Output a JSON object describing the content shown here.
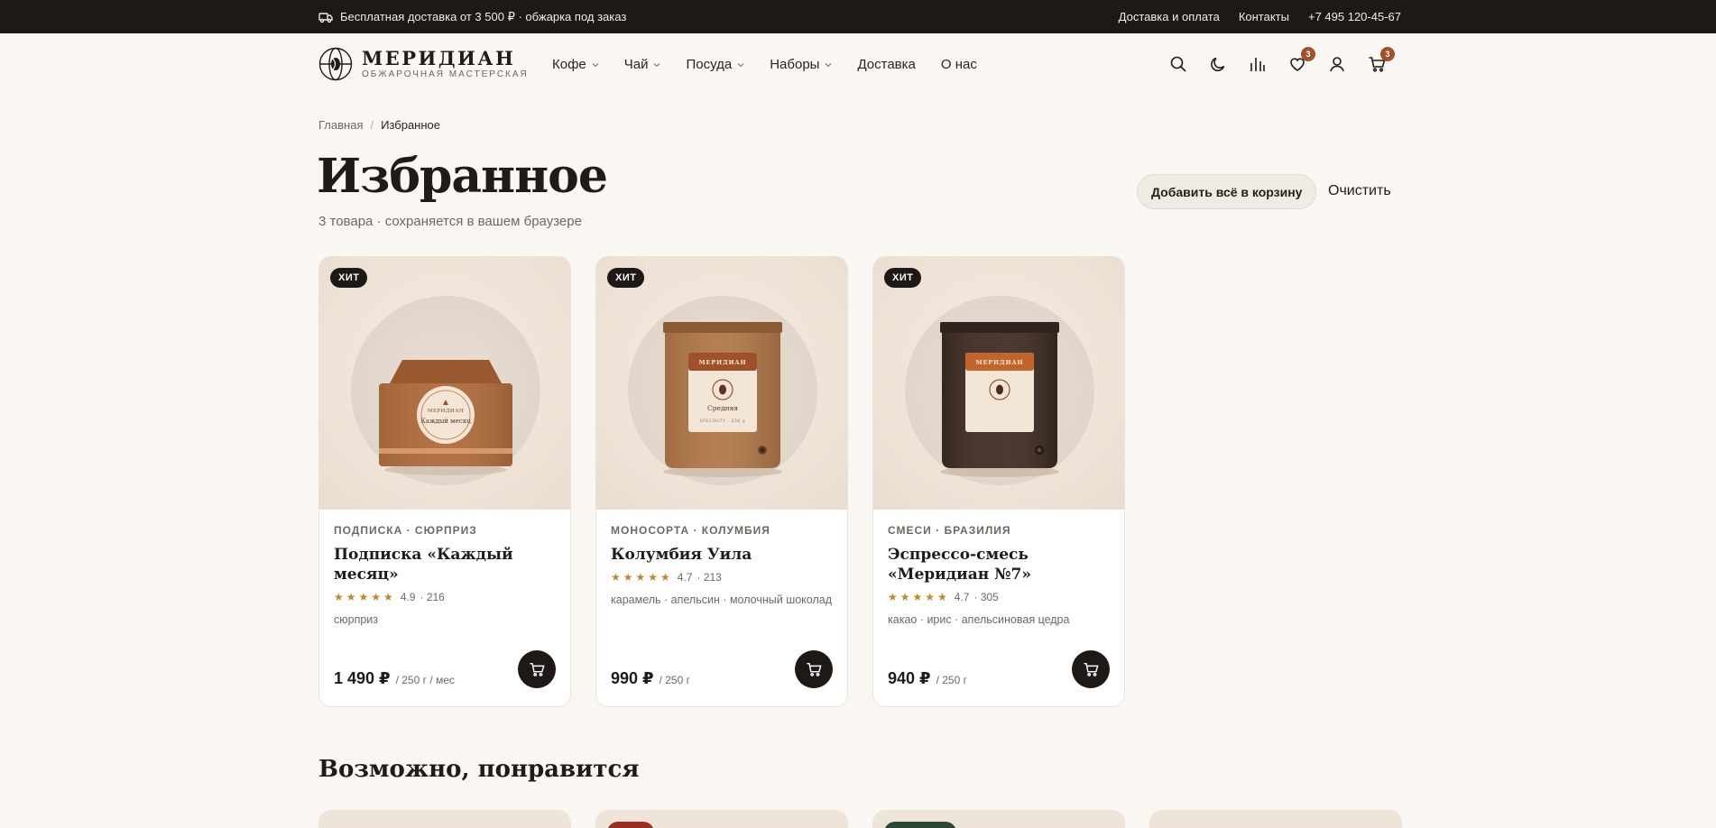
{
  "topbar": {
    "promo": "Бесплатная доставка от 3 500 ₽ · обжарка под заказ",
    "links": [
      "Доставка и оплата",
      "Контакты",
      "+7 495 120-45-67"
    ]
  },
  "logo": {
    "name": "МЕРИДИАН",
    "subtitle": "ОБЖАРОЧНАЯ МАСТЕРСКАЯ"
  },
  "nav": [
    {
      "label": "Кофе",
      "dropdown": true
    },
    {
      "label": "Чай",
      "dropdown": true
    },
    {
      "label": "Посуда",
      "dropdown": true
    },
    {
      "label": "Наборы",
      "dropdown": true
    },
    {
      "label": "Доставка",
      "dropdown": false
    },
    {
      "label": "О нас",
      "dropdown": false
    }
  ],
  "header_icons": {
    "favorites_count": "3",
    "cart_count": "3"
  },
  "breadcrumb": {
    "home": "Главная",
    "separator": "/",
    "current": "Избранное"
  },
  "page": {
    "title": "Избранное",
    "subtitle": "3 товара · сохраняется в вашем браузере",
    "add_all_label": "Добавить всё в корзину",
    "clear_label": "Очистить"
  },
  "products": [
    {
      "badge": "ХИТ",
      "category": "ПОДПИСКА · СЮРПРИЗ",
      "name": "Подписка «Каждый месяц»",
      "stars": "★★★★★",
      "rating": "4.9",
      "reviews": "· 216",
      "notes": "сюрприз",
      "price": "1 490 ₽",
      "unit": "/ 250 г / мес",
      "image": "box",
      "label_brand": "МЕРИДИАН",
      "label_text": "Каждый месяц"
    },
    {
      "badge": "ХИТ",
      "category": "МОНОСОРТА · КОЛУМБИЯ",
      "name": "Колумбия Уила",
      "stars": "★★★★★",
      "rating": "4.7",
      "reviews": "· 213",
      "notes": "карамель · апельсин · молочный шоколад",
      "price": "990 ₽",
      "unit": "/ 250 г",
      "image": "bag-brown",
      "label_brand": "МЕРИДИАН",
      "label_text": "Средняя",
      "label_foot": "SPECIALTY · 250 g"
    },
    {
      "badge": "ХИТ",
      "category": "СМЕСИ · БРАЗИЛИЯ",
      "name": "Эспрессо-смесь «Меридиан №7»",
      "stars": "★★★★★",
      "rating": "4.7",
      "reviews": "· 305",
      "notes": "какао · ирис · апельсиновая цедра",
      "price": "940 ₽",
      "unit": "/ 250 г",
      "image": "bag-dark",
      "label_brand": "МЕРИДИАН"
    }
  ],
  "recommendations": {
    "title": "Возможно, понравится"
  },
  "colors": {
    "accent": "#a0512a",
    "dark": "#1e1917",
    "star": "#c1862a",
    "background": "#faf7f3"
  }
}
